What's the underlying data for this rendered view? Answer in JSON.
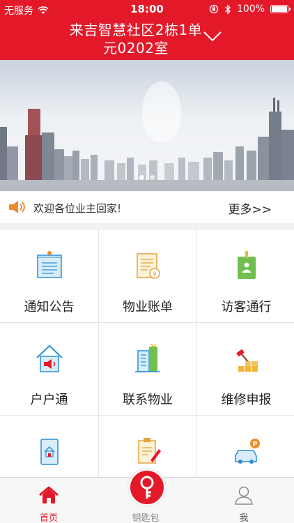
{
  "status_bar": {
    "carrier": "无服务",
    "time": "18:00",
    "battery": "100%"
  },
  "header": {
    "title": "来吉智慧社区2栋1单元0202室"
  },
  "banner": {
    "slide_count": 2,
    "active_slide": 1
  },
  "notice": {
    "message": "欢迎各位业主回家!",
    "more_label": "更多>>"
  },
  "grid": {
    "items": [
      {
        "label": "通知公告",
        "icon": "notice-board-icon"
      },
      {
        "label": "物业账单",
        "icon": "bill-icon"
      },
      {
        "label": "访客通行",
        "icon": "visitor-pass-icon"
      },
      {
        "label": "户户通",
        "icon": "house-speaker-icon"
      },
      {
        "label": "联系物业",
        "icon": "building-icon"
      },
      {
        "label": "维修申报",
        "icon": "repair-hammer-icon"
      },
      {
        "label": "",
        "icon": "tablet-home-icon"
      },
      {
        "label": "",
        "icon": "document-pen-icon"
      },
      {
        "label": "",
        "icon": "parking-car-icon"
      }
    ]
  },
  "tabbar": {
    "home": "首页",
    "keys": "钥匙包",
    "me": "我"
  },
  "colors": {
    "brand_red": "#e3192a"
  }
}
